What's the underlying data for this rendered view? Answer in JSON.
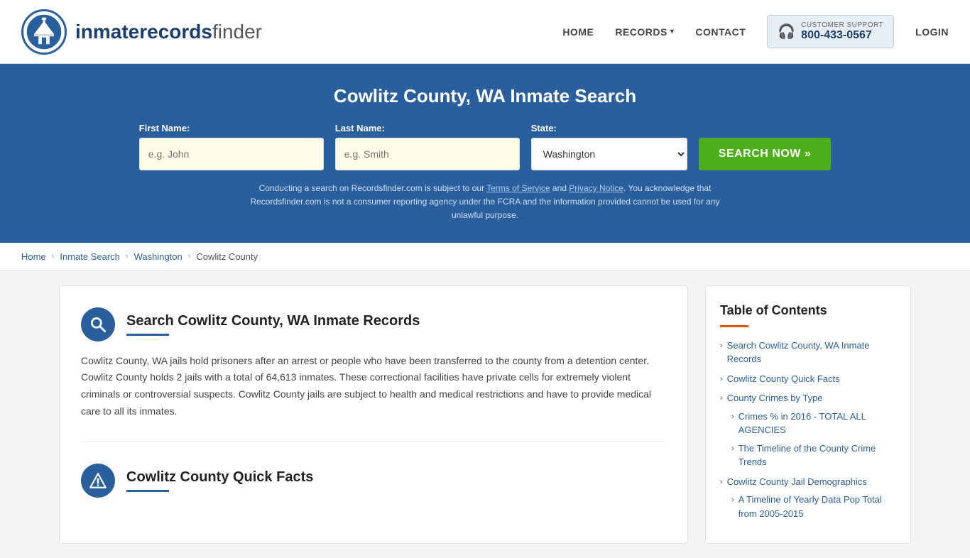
{
  "header": {
    "logo_text_light": "inmaterecords",
    "logo_text_bold": "finder",
    "nav": {
      "home": "HOME",
      "records": "RECORDS",
      "contact": "CONTACT",
      "login": "LOGIN"
    },
    "support": {
      "label": "CUSTOMER SUPPORT",
      "number": "800-433-0567"
    }
  },
  "hero": {
    "title": "Cowlitz County, WA Inmate Search",
    "form": {
      "first_name_label": "First Name:",
      "first_name_placeholder": "e.g. John",
      "last_name_label": "Last Name:",
      "last_name_placeholder": "e.g. Smith",
      "state_label": "State:",
      "state_value": "Washington",
      "search_button": "SEARCH NOW »"
    },
    "disclaimer": "Conducting a search on Recordsfinder.com is subject to our Terms of Service and Privacy Notice. You acknowledge that Recordsfinder.com is not a consumer reporting agency under the FCRA and the information provided cannot be used for any unlawful purpose."
  },
  "breadcrumb": {
    "items": [
      "Home",
      "Inmate Search",
      "Washington",
      "Cowlitz County"
    ]
  },
  "main": {
    "section1": {
      "title": "Search Cowlitz County, WA Inmate Records",
      "body": "Cowlitz County, WA jails hold prisoners after an arrest or people who have been transferred to the county from a detention center. Cowlitz County holds 2 jails with a total of 64,613 inmates. These correctional facilities have private cells for extremely violent criminals or controversial suspects. Cowlitz County jails are subject to health and medical restrictions and have to provide medical care to all its inmates."
    },
    "section2": {
      "title": "Cowlitz County Quick Facts"
    }
  },
  "toc": {
    "title": "Table of Contents",
    "items": [
      {
        "label": "Search Cowlitz County, WA Inmate Records",
        "sub": false
      },
      {
        "label": "Cowlitz County Quick Facts",
        "sub": false
      },
      {
        "label": "County Crimes by Type",
        "sub": false
      },
      {
        "label": "Crimes % in 2016 - TOTAL ALL AGENCIES",
        "sub": true
      },
      {
        "label": "The Timeline of the County Crime Trends",
        "sub": true
      },
      {
        "label": "Cowlitz County Jail Demographics",
        "sub": false
      },
      {
        "label": "A Timeline of Yearly Data Pop Total from 2005-2015",
        "sub": true
      }
    ]
  }
}
